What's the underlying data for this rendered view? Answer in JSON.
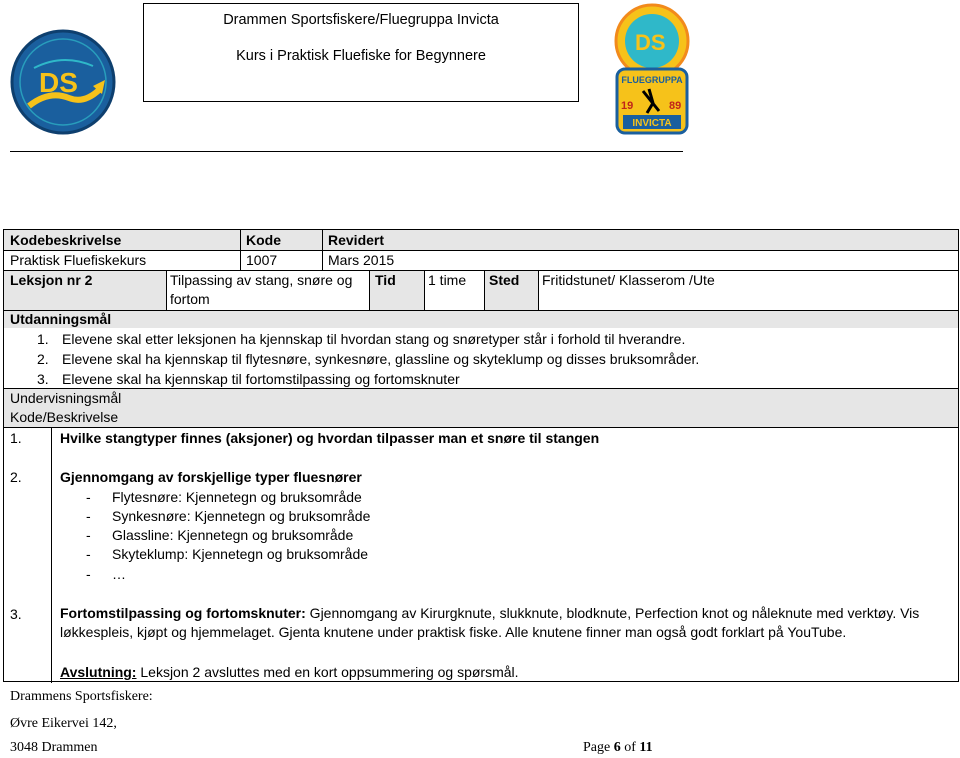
{
  "header": {
    "title_line1": "Drammen Sportsfiskere/Fluegruppa Invicta",
    "title_line2": "Kurs i Praktisk Fluefiske for Begynnere",
    "logo_left": {
      "text": "DS"
    },
    "logo_right": {
      "top_text": "DS",
      "banner": "FLUEGRUPPA",
      "year_left": "19",
      "year_right": "89",
      "bottom_text": "INVICTA"
    }
  },
  "table": {
    "row1": {
      "kodebeskrivelse": "Kodebeskrivelse",
      "kode": "Kode",
      "revidert": "Revidert"
    },
    "row2": {
      "kodebeskrivelse": "Praktisk Fluefiskekurs",
      "kode": "1007",
      "revidert": "Mars 2015"
    },
    "row3": {
      "leksjon": "Leksjon nr 2",
      "tema_line1": "Tilpassing av stang, snøre og",
      "tema_line2": "fortom",
      "tid_label": "Tid",
      "tid_value": "1 time",
      "sted_label": "Sted",
      "sted_value": "Fritidstunet/ Klasserom /Ute"
    },
    "utdanningsmal": {
      "heading": "Utdanningsmål",
      "items": [
        {
          "num": "1.",
          "text": "Elevene skal etter leksjonen ha kjennskap til hvordan stang og snøretyper står i forhold til hverandre."
        },
        {
          "num": "2.",
          "text": "Elevene skal ha kjennskap til flytesnøre, synkesnøre, glassline og skyteklump og disses bruksområder."
        },
        {
          "num": "3.",
          "text": "Elevene skal ha kjennskap til fortomstilpassing og fortomsknuter"
        }
      ]
    },
    "undervisning": {
      "heading": "Undervisningsmål",
      "subheading": "Kode/Beskrivelse",
      "item1": {
        "num": "1.",
        "title": "Hvilke stangtyper finnes (aksjoner) og hvordan tilpasser man et snøre til stangen"
      },
      "item2": {
        "num": "2.",
        "title": "Gjennomgang av forskjellige typer fluesnører",
        "bullets": [
          {
            "dash": "-",
            "text": "Flytesnøre: Kjennetegn og bruksområde"
          },
          {
            "dash": "-",
            "text": "Synkesnøre: Kjennetegn og bruksområde"
          },
          {
            "dash": "-",
            "text": "Glassline: Kjennetegn og bruksområde"
          },
          {
            "dash": "-",
            "text": "Skyteklump: Kjennetegn og bruksområde"
          },
          {
            "dash": "-",
            "text": "…"
          }
        ]
      },
      "item3": {
        "num": "3.",
        "title": "Fortomstilpassing og fortomsknuter:",
        "text": " Gjennomgang av Kirurgknute, slukknute, blodknute, Perfection knot og nåleknute med verktøy. Vis løkkespleis, kjøpt og hjemmelaget. Gjenta knutene under praktisk fiske. Alle knutene finner man også godt forklart på YouTube."
      },
      "avslutning": {
        "label": "Avslutning:",
        "text": " Leksjon 2 avsluttes med en kort oppsummering og spørsmål."
      }
    }
  },
  "footer": {
    "line1": "Drammens Sportsfiskere:",
    "line2": "Øvre Eikervei 142,",
    "line3": "3048 Drammen",
    "page_word": "Page",
    "page_num": "6",
    "of_word": "of",
    "page_total": "11"
  },
  "colors": {
    "shade": "#e6e6e6",
    "logo_blue": "#1a5f9e",
    "logo_yellow": "#f6c21a",
    "logo_orange": "#f28a1c",
    "logo_teal": "#2fb8c9"
  }
}
